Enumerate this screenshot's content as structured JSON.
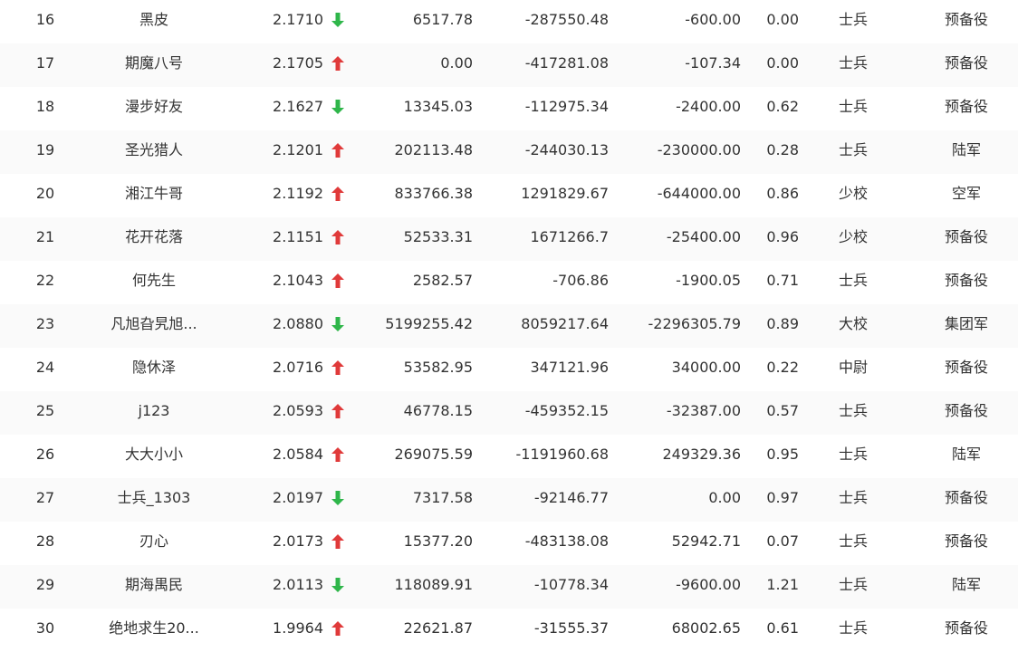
{
  "colors": {
    "up": "#e03a3a",
    "down": "#2fb64a",
    "text": "#333333"
  },
  "rows": [
    {
      "rank": "16",
      "name": "黑皮",
      "score": "2.1710",
      "trend": "down",
      "v1": "6517.78",
      "v2": "-287550.48",
      "v3": "-600.00",
      "v4": "0.00",
      "rank_name": "士兵",
      "unit": "预备役"
    },
    {
      "rank": "17",
      "name": "期魔八号",
      "score": "2.1705",
      "trend": "up",
      "v1": "0.00",
      "v2": "-417281.08",
      "v3": "-107.34",
      "v4": "0.00",
      "rank_name": "士兵",
      "unit": "预备役"
    },
    {
      "rank": "18",
      "name": "漫步好友",
      "score": "2.1627",
      "trend": "down",
      "v1": "13345.03",
      "v2": "-112975.34",
      "v3": "-2400.00",
      "v4": "0.62",
      "rank_name": "士兵",
      "unit": "预备役"
    },
    {
      "rank": "19",
      "name": "圣光猎人",
      "score": "2.1201",
      "trend": "up",
      "v1": "202113.48",
      "v2": "-244030.13",
      "v3": "-230000.00",
      "v4": "0.28",
      "rank_name": "士兵",
      "unit": "陆军"
    },
    {
      "rank": "20",
      "name": "湘江牛哥",
      "score": "2.1192",
      "trend": "up",
      "v1": "833766.38",
      "v2": "1291829.67",
      "v3": "-644000.00",
      "v4": "0.86",
      "rank_name": "少校",
      "unit": "空军"
    },
    {
      "rank": "21",
      "name": "花开花落",
      "score": "2.1151",
      "trend": "up",
      "v1": "52533.31",
      "v2": "1671266.7",
      "v3": "-25400.00",
      "v4": "0.96",
      "rank_name": "少校",
      "unit": "预备役"
    },
    {
      "rank": "22",
      "name": "何先生",
      "score": "2.1043",
      "trend": "up",
      "v1": "2582.57",
      "v2": "-706.86",
      "v3": "-1900.05",
      "v4": "0.71",
      "rank_name": "士兵",
      "unit": "预备役"
    },
    {
      "rank": "23",
      "name": "凡旭旮旯旭...",
      "score": "2.0880",
      "trend": "down",
      "v1": "5199255.42",
      "v2": "8059217.64",
      "v3": "-2296305.79",
      "v4": "0.89",
      "rank_name": "大校",
      "unit": "集团军"
    },
    {
      "rank": "24",
      "name": "隐休泽",
      "score": "2.0716",
      "trend": "up",
      "v1": "53582.95",
      "v2": "347121.96",
      "v3": "34000.00",
      "v4": "0.22",
      "rank_name": "中尉",
      "unit": "预备役"
    },
    {
      "rank": "25",
      "name": "j123",
      "score": "2.0593",
      "trend": "up",
      "v1": "46778.15",
      "v2": "-459352.15",
      "v3": "-32387.00",
      "v4": "0.57",
      "rank_name": "士兵",
      "unit": "预备役"
    },
    {
      "rank": "26",
      "name": "大大小小",
      "score": "2.0584",
      "trend": "up",
      "v1": "269075.59",
      "v2": "-1191960.68",
      "v3": "249329.36",
      "v4": "0.95",
      "rank_name": "士兵",
      "unit": "陆军"
    },
    {
      "rank": "27",
      "name": "士兵_1303",
      "score": "2.0197",
      "trend": "down",
      "v1": "7317.58",
      "v2": "-92146.77",
      "v3": "0.00",
      "v4": "0.97",
      "rank_name": "士兵",
      "unit": "预备役"
    },
    {
      "rank": "28",
      "name": "刃心",
      "score": "2.0173",
      "trend": "up",
      "v1": "15377.20",
      "v2": "-483138.08",
      "v3": "52942.71",
      "v4": "0.07",
      "rank_name": "士兵",
      "unit": "预备役"
    },
    {
      "rank": "29",
      "name": "期海禺民",
      "score": "2.0113",
      "trend": "down",
      "v1": "118089.91",
      "v2": "-10778.34",
      "v3": "-9600.00",
      "v4": "1.21",
      "rank_name": "士兵",
      "unit": "陆军"
    },
    {
      "rank": "30",
      "name": "绝地求生20...",
      "score": "1.9964",
      "trend": "up",
      "v1": "22621.87",
      "v2": "-31555.37",
      "v3": "68002.65",
      "v4": "0.61",
      "rank_name": "士兵",
      "unit": "预备役"
    }
  ]
}
